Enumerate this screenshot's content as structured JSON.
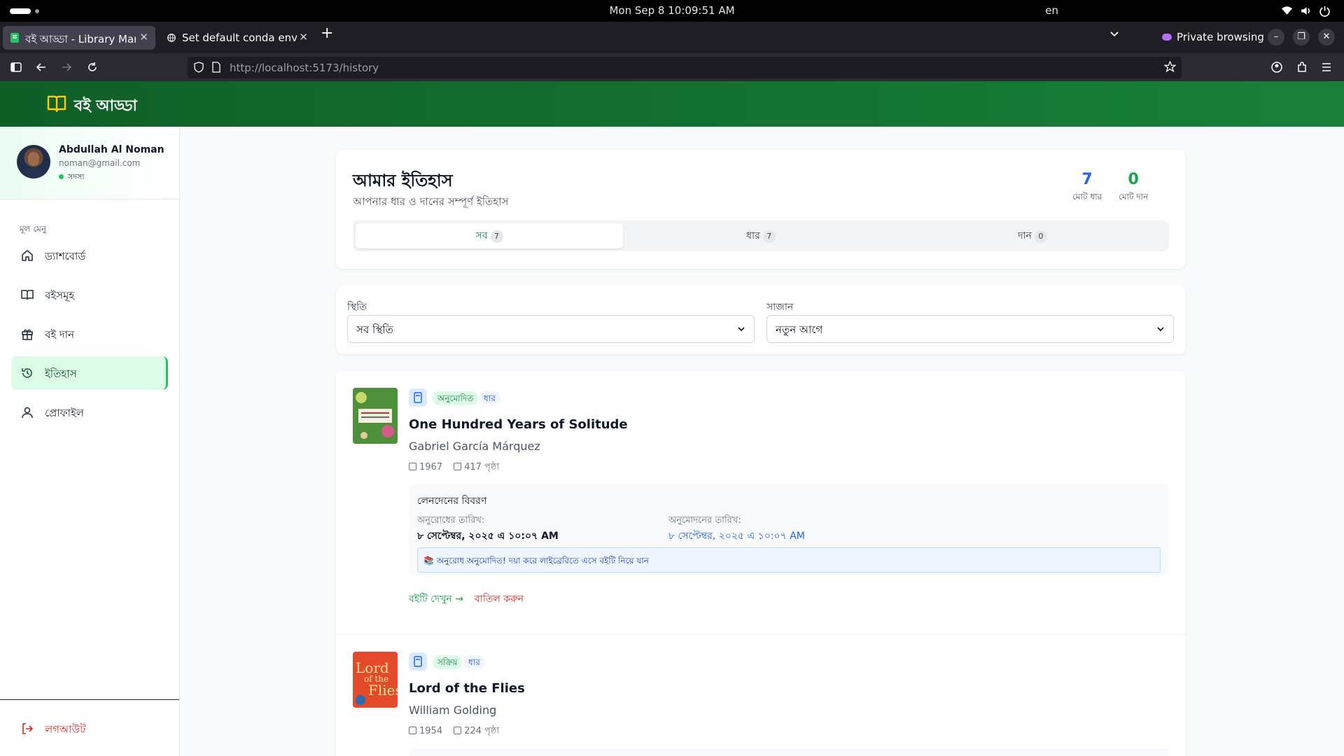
{
  "os": {
    "clock": "Mon Sep 8  10:09:51 AM",
    "lang": "en"
  },
  "browser": {
    "tabs": [
      {
        "label": "বই আড্ডা - Library Manage",
        "active": true
      },
      {
        "label": "Set default conda env",
        "active": false
      }
    ],
    "private_label": "Private browsing",
    "url_host": "http://localhost",
    "url_path": ":5173/history"
  },
  "app": {
    "brand": "বই আড্ডা",
    "user": {
      "name": "Abdullah Al Noman",
      "email": "noman@gmail.com",
      "role": "সদস্য"
    },
    "menu_title": "মূল মেনু",
    "menu": [
      {
        "label": "ড্যাশবোর্ড",
        "icon": "home-icon"
      },
      {
        "label": "বইসমূহ",
        "icon": "book-open-icon"
      },
      {
        "label": "বই দান",
        "icon": "gift-icon"
      },
      {
        "label": "ইতিহাস",
        "icon": "history-icon",
        "active": true
      },
      {
        "label": "প্রোফাইল",
        "icon": "user-icon"
      }
    ],
    "logout": "লগআউট"
  },
  "history": {
    "title": "আমার ইতিহাস",
    "subtitle": "আপনার ধার ও দানের সম্পূর্ণ ইতিহাস",
    "stats": {
      "borrow_count": "7",
      "borrow_label": "মোট ধার",
      "donate_count": "0",
      "donate_label": "মোট দান"
    },
    "tabs": [
      {
        "label": "সব",
        "count": "7",
        "active": true
      },
      {
        "label": "ধার",
        "count": "7"
      },
      {
        "label": "দান",
        "count": "0"
      }
    ],
    "filters": {
      "status_label": "স্থিতি",
      "status_value": "সব স্থিতি",
      "sort_label": "সাজান",
      "sort_value": "নতুন আগে"
    },
    "items": [
      {
        "status": "অনুমোদিত",
        "type": "ধার",
        "title": "One Hundred Years of Solitude",
        "author": "Gabriel García Márquez",
        "year": "1967",
        "pages": "417 পৃষ্ঠা",
        "tx_title": "লেনদেনের বিবরণ",
        "request_label": "অনুরোধের তারিখ:",
        "request_date": "৮ সেপ্টেম্বর, ২০২৫ এ ১০:০৭ AM",
        "approve_label": "অনুমোদনের তারিখ:",
        "approve_date": "৮ সেপ্টেম্বর, ২০২৫ এ ১০:০৭ AM",
        "note": "📚 অনুরোধ অনুমোদিত! দয়া করে লাইব্রেরিতে এসে বইটি নিয়ে যান",
        "view_label": "বইটি দেখুন →",
        "cancel_label": "বাতিল করুন"
      },
      {
        "status": "সক্রিয়",
        "type": "ধার",
        "title": "Lord of the Flies",
        "author": "William Golding",
        "year": "1954",
        "pages": "224 পৃষ্ঠা",
        "cover_text_1": "Lord",
        "cover_text_2": "of the",
        "cover_text_3": "Flies"
      }
    ]
  },
  "colors": {
    "header_green": "#0f5f27",
    "accent_green": "#16a34a",
    "accent_blue": "#2563eb",
    "danger": "#dc2626"
  }
}
